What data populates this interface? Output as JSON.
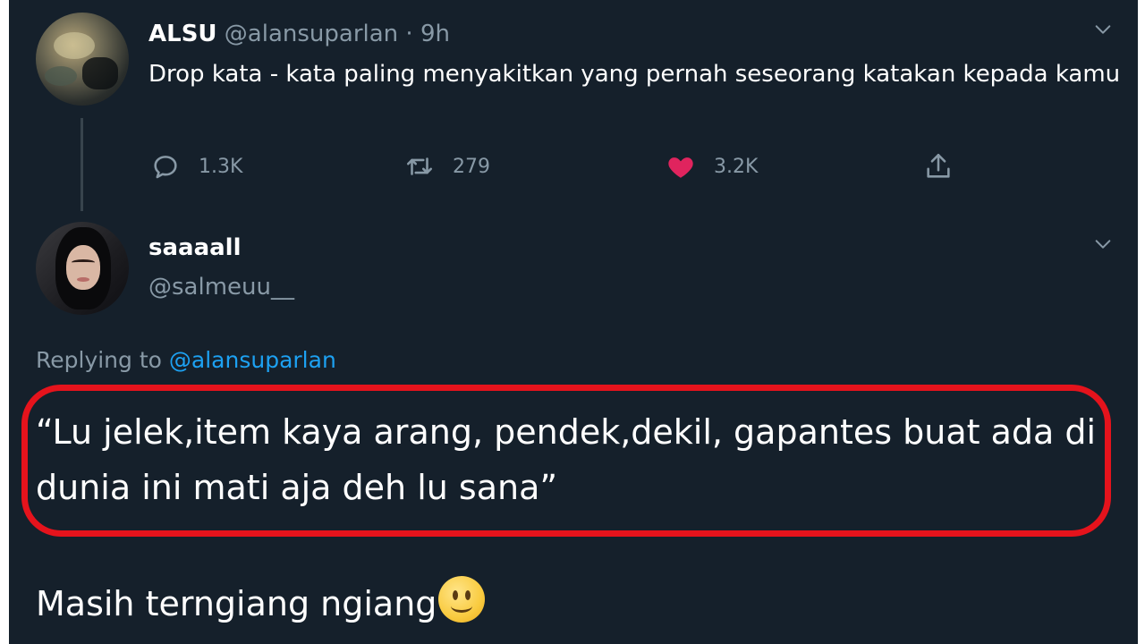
{
  "parent_tweet": {
    "name": "ALSU",
    "handle": "@alansuparlan",
    "separator": "·",
    "time": "9h",
    "text": "Drop kata - kata paling menyakitkan yang pernah seseorang katakan kepada kamu",
    "actions": {
      "replies": "1.3K",
      "retweets": "279",
      "likes": "3.2K",
      "liked": true
    }
  },
  "reply_tweet": {
    "name": "saaaall",
    "handle": "@salmeuu__",
    "replying_prefix": "Replying to",
    "replying_mention": "@alansuparlan",
    "text": "“Lu jelek,item kaya arang, pendek,dekil, gapantes buat ada di dunia ini mati aja deh lu sana”",
    "footer_text": "Masih terngiang ngiang",
    "footer_emoji": "slightly-smiling-face"
  },
  "colors": {
    "background": "#15202b",
    "text": "#ffffff",
    "muted": "#8899a6",
    "link": "#1da1f2",
    "like": "#e0245e",
    "highlight_border": "#e5131c"
  }
}
